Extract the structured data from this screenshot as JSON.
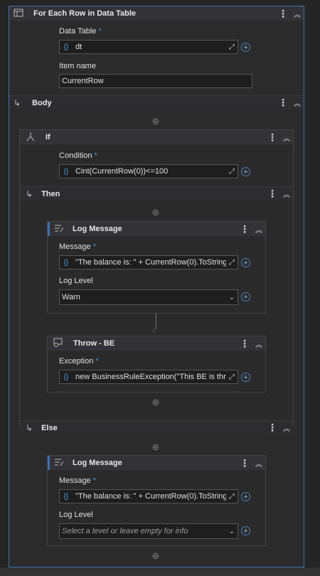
{
  "foreach": {
    "title": "For Each Row in Data Table",
    "datatable_label": "Data Table",
    "required_mark": "*",
    "datatable_value": "dt",
    "itemname_label": "Item name",
    "itemname_value": "CurrentRow"
  },
  "body": {
    "title": "Body"
  },
  "if_block": {
    "title": "If",
    "condition_label": "Condition",
    "condition_value": "Cint(CurrentRow(0))<=100"
  },
  "then_block": {
    "title": "Then"
  },
  "log1": {
    "title": "Log Message",
    "message_label": "Message",
    "message_value": "\"The balance is: \" + CurrentRow(0).ToString",
    "level_label": "Log Level",
    "level_value": "Warn"
  },
  "throw": {
    "title": "Throw - BE",
    "exception_label": "Exception",
    "exception_value": "new BusinessRuleException(\"This BE is thrown\")"
  },
  "else_block": {
    "title": "Else"
  },
  "log2": {
    "title": "Log Message",
    "message_label": "Message",
    "message_value": "\"The balance is: \" + CurrentRow(0).ToString",
    "level_label": "Log Level",
    "level_placeholder": "Select a level or leave empty for info"
  },
  "icons": {
    "expression": "{}",
    "expand": "⤢",
    "plus": "+",
    "kebab": "⋮",
    "collapse": "︽",
    "dropdown": "⌄",
    "add": "⊕",
    "arrow_down": "↓"
  },
  "colors": {
    "accent": "#3c6fb5",
    "background": "#252526",
    "header": "#333337"
  }
}
